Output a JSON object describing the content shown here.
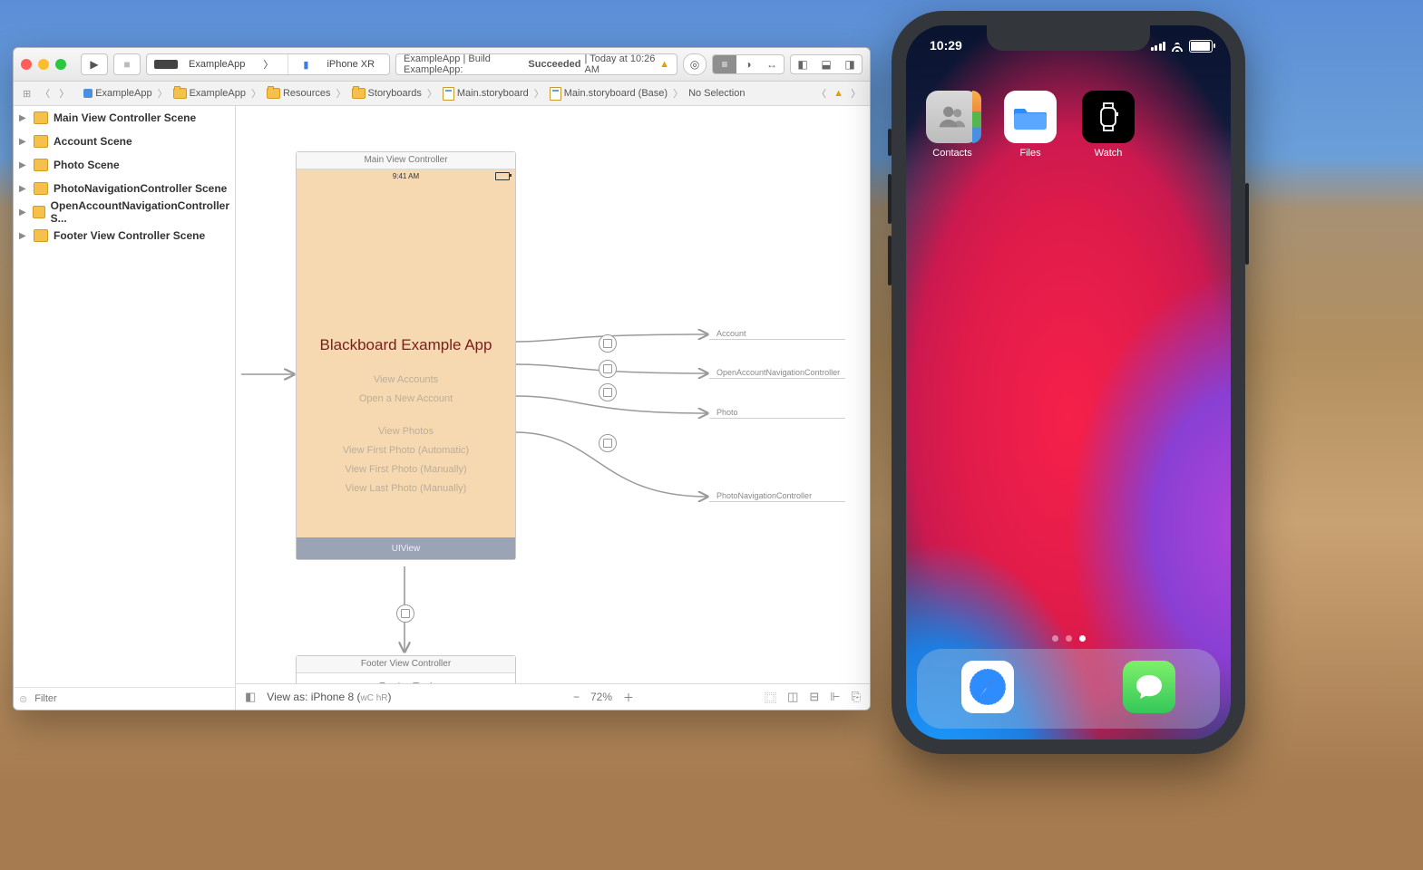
{
  "toolbar": {
    "scheme_target": "ExampleApp",
    "scheme_device": "iPhone XR",
    "status_prefix": "ExampleApp | Build ExampleApp: ",
    "status_result": "Succeeded",
    "status_time": " | Today at 10:26 AM"
  },
  "breadcrumbs": {
    "items": [
      "ExampleApp",
      "ExampleApp",
      "Resources",
      "Storyboards",
      "Main.storyboard",
      "Main.storyboard (Base)",
      "No Selection"
    ]
  },
  "outline": {
    "items": [
      {
        "label": "Main View Controller Scene"
      },
      {
        "label": "Account Scene"
      },
      {
        "label": "Photo Scene"
      },
      {
        "label": "PhotoNavigationController Scene"
      },
      {
        "label": "OpenAccountNavigationController S..."
      },
      {
        "label": "Footer View Controller Scene"
      }
    ],
    "filter_placeholder": "Filter"
  },
  "scene": {
    "header": "Main View Controller",
    "statusbar_time": "9:41 AM",
    "title": "Blackboard Example App",
    "buttons": [
      "View Accounts",
      "Open a New Account",
      "View Photos",
      "View First Photo (Automatic)",
      "View First Photo (Manually)",
      "View Last Photo (Manually)"
    ],
    "uiview_label": "UIView",
    "footer_header": "Footer View Controller",
    "footer_text": "Footer Text",
    "segues": [
      "Account",
      "OpenAccountNavigationController",
      "Photo",
      "PhotoNavigationController"
    ]
  },
  "ibfooter": {
    "view_as": "View as: iPhone 8 (",
    "size_class": "wC hR",
    "view_as_close": ")",
    "zoom": "72%"
  },
  "simulator": {
    "time": "10:29",
    "apps": [
      {
        "label": "Contacts",
        "bg": "linear-gradient(#d7d7d7,#b8b8b8)",
        "glyph": "👥",
        "extra": true
      },
      {
        "label": "Files",
        "bg": "#fff",
        "glyph": "📁"
      },
      {
        "label": "Watch",
        "bg": "#000",
        "glyph": "⌚"
      }
    ],
    "dock": [
      {
        "label": "Safari",
        "bg": "#fff",
        "glyph": "🧭"
      },
      {
        "label": "Messages",
        "bg": "linear-gradient(#6fe25a,#34c759)",
        "glyph": "💬"
      }
    ]
  }
}
